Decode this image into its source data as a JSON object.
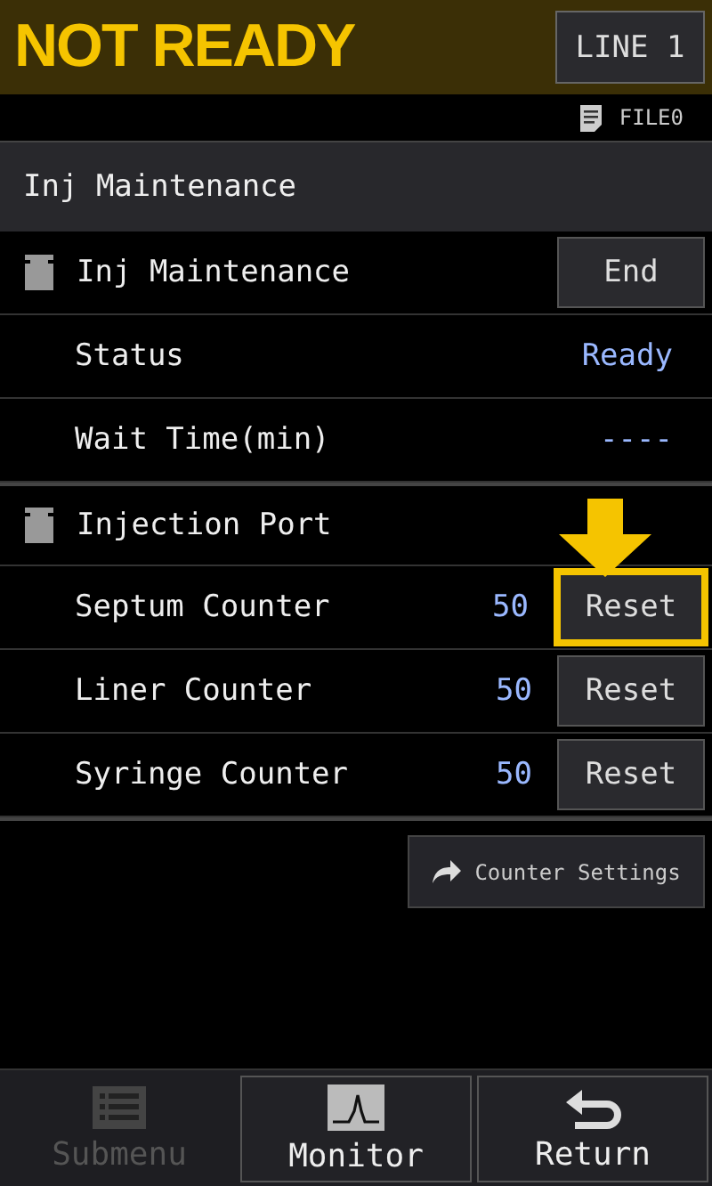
{
  "header": {
    "status": "NOT READY",
    "line_button": "LINE 1"
  },
  "file_bar": {
    "file": "FILE0"
  },
  "title": "Inj Maintenance",
  "rows": [
    {
      "kind": "section",
      "label": "Inj Maintenance",
      "button": "End"
    },
    {
      "kind": "item",
      "label": "Status",
      "value": "Ready"
    },
    {
      "kind": "item",
      "label": "Wait Time(min)",
      "value": "----"
    },
    {
      "kind": "section",
      "label": "Injection Port"
    },
    {
      "kind": "item",
      "label": "Septum Counter",
      "value": "50",
      "button": "Reset",
      "highlighted": true
    },
    {
      "kind": "item",
      "label": "Liner Counter",
      "value": "50",
      "button": "Reset",
      "highlighted": false
    },
    {
      "kind": "item",
      "label": "Syringe Counter",
      "value": "50",
      "button": "Reset",
      "highlighted": false
    }
  ],
  "settings_button": "Counter Settings",
  "bottom_buttons": [
    {
      "kind": "submenu",
      "label": "Submenu",
      "disabled": true
    },
    {
      "kind": "monitor",
      "label": "Monitor",
      "disabled": false
    },
    {
      "kind": "return",
      "label": "Return",
      "disabled": false
    }
  ]
}
